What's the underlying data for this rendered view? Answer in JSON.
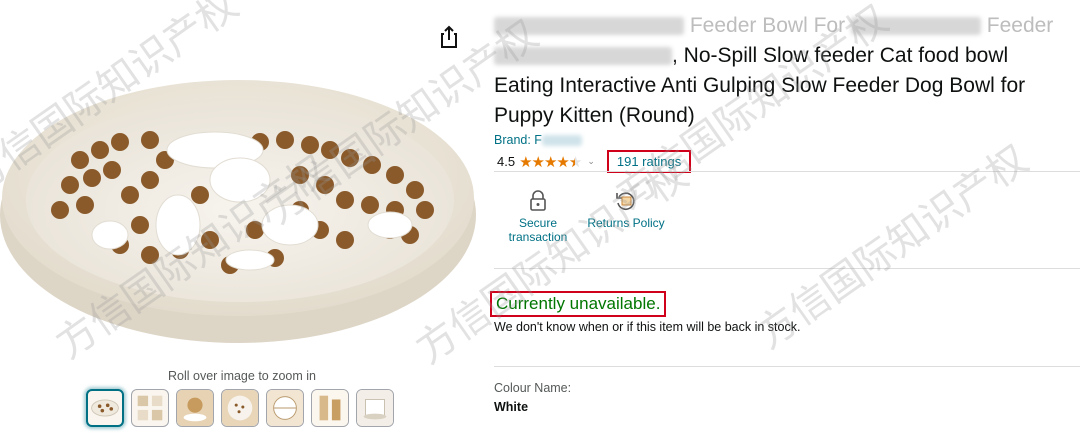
{
  "product": {
    "title_line1_visible": "Feeder Bowl For",
    "title_line1_tail": "Feeder",
    "title_line2_visible": ", No-Spill Slow feeder Cat food bowl",
    "title_line3": "Eating Interactive Anti Gulping Slow Feeder Dog Bowl for",
    "title_line4": "Puppy Kitten (Round)",
    "brand_label": "Brand: F",
    "rating_value": "4.5",
    "rating_stars": 4.5,
    "ratings_count_text": "191 ratings"
  },
  "badges": [
    {
      "label_line1": "Secure",
      "label_line2": "transaction",
      "icon": "lock-icon"
    },
    {
      "label": "Returns Policy",
      "icon": "returns-icon"
    }
  ],
  "availability": {
    "status": "Currently unavailable.",
    "message": "We don't know when or if this item will be back in stock."
  },
  "variation": {
    "label": "Colour Name:",
    "value": "White"
  },
  "gallery": {
    "zoom_hint": "Roll over image to zoom in",
    "thumbnails": [
      {
        "name": "thumb-bowl-top",
        "selected": true
      },
      {
        "name": "thumb-feature-grid"
      },
      {
        "name": "thumb-lifestyle-dog"
      },
      {
        "name": "thumb-bowl-kibble"
      },
      {
        "name": "thumb-dimensions"
      },
      {
        "name": "thumb-usage-cat"
      },
      {
        "name": "thumb-package"
      }
    ]
  },
  "watermark_text": "方信国际知识产权",
  "colors": {
    "link": "#007185",
    "star": "#e67a00",
    "available_green": "#007600",
    "highlight_red": "#d0021b"
  }
}
